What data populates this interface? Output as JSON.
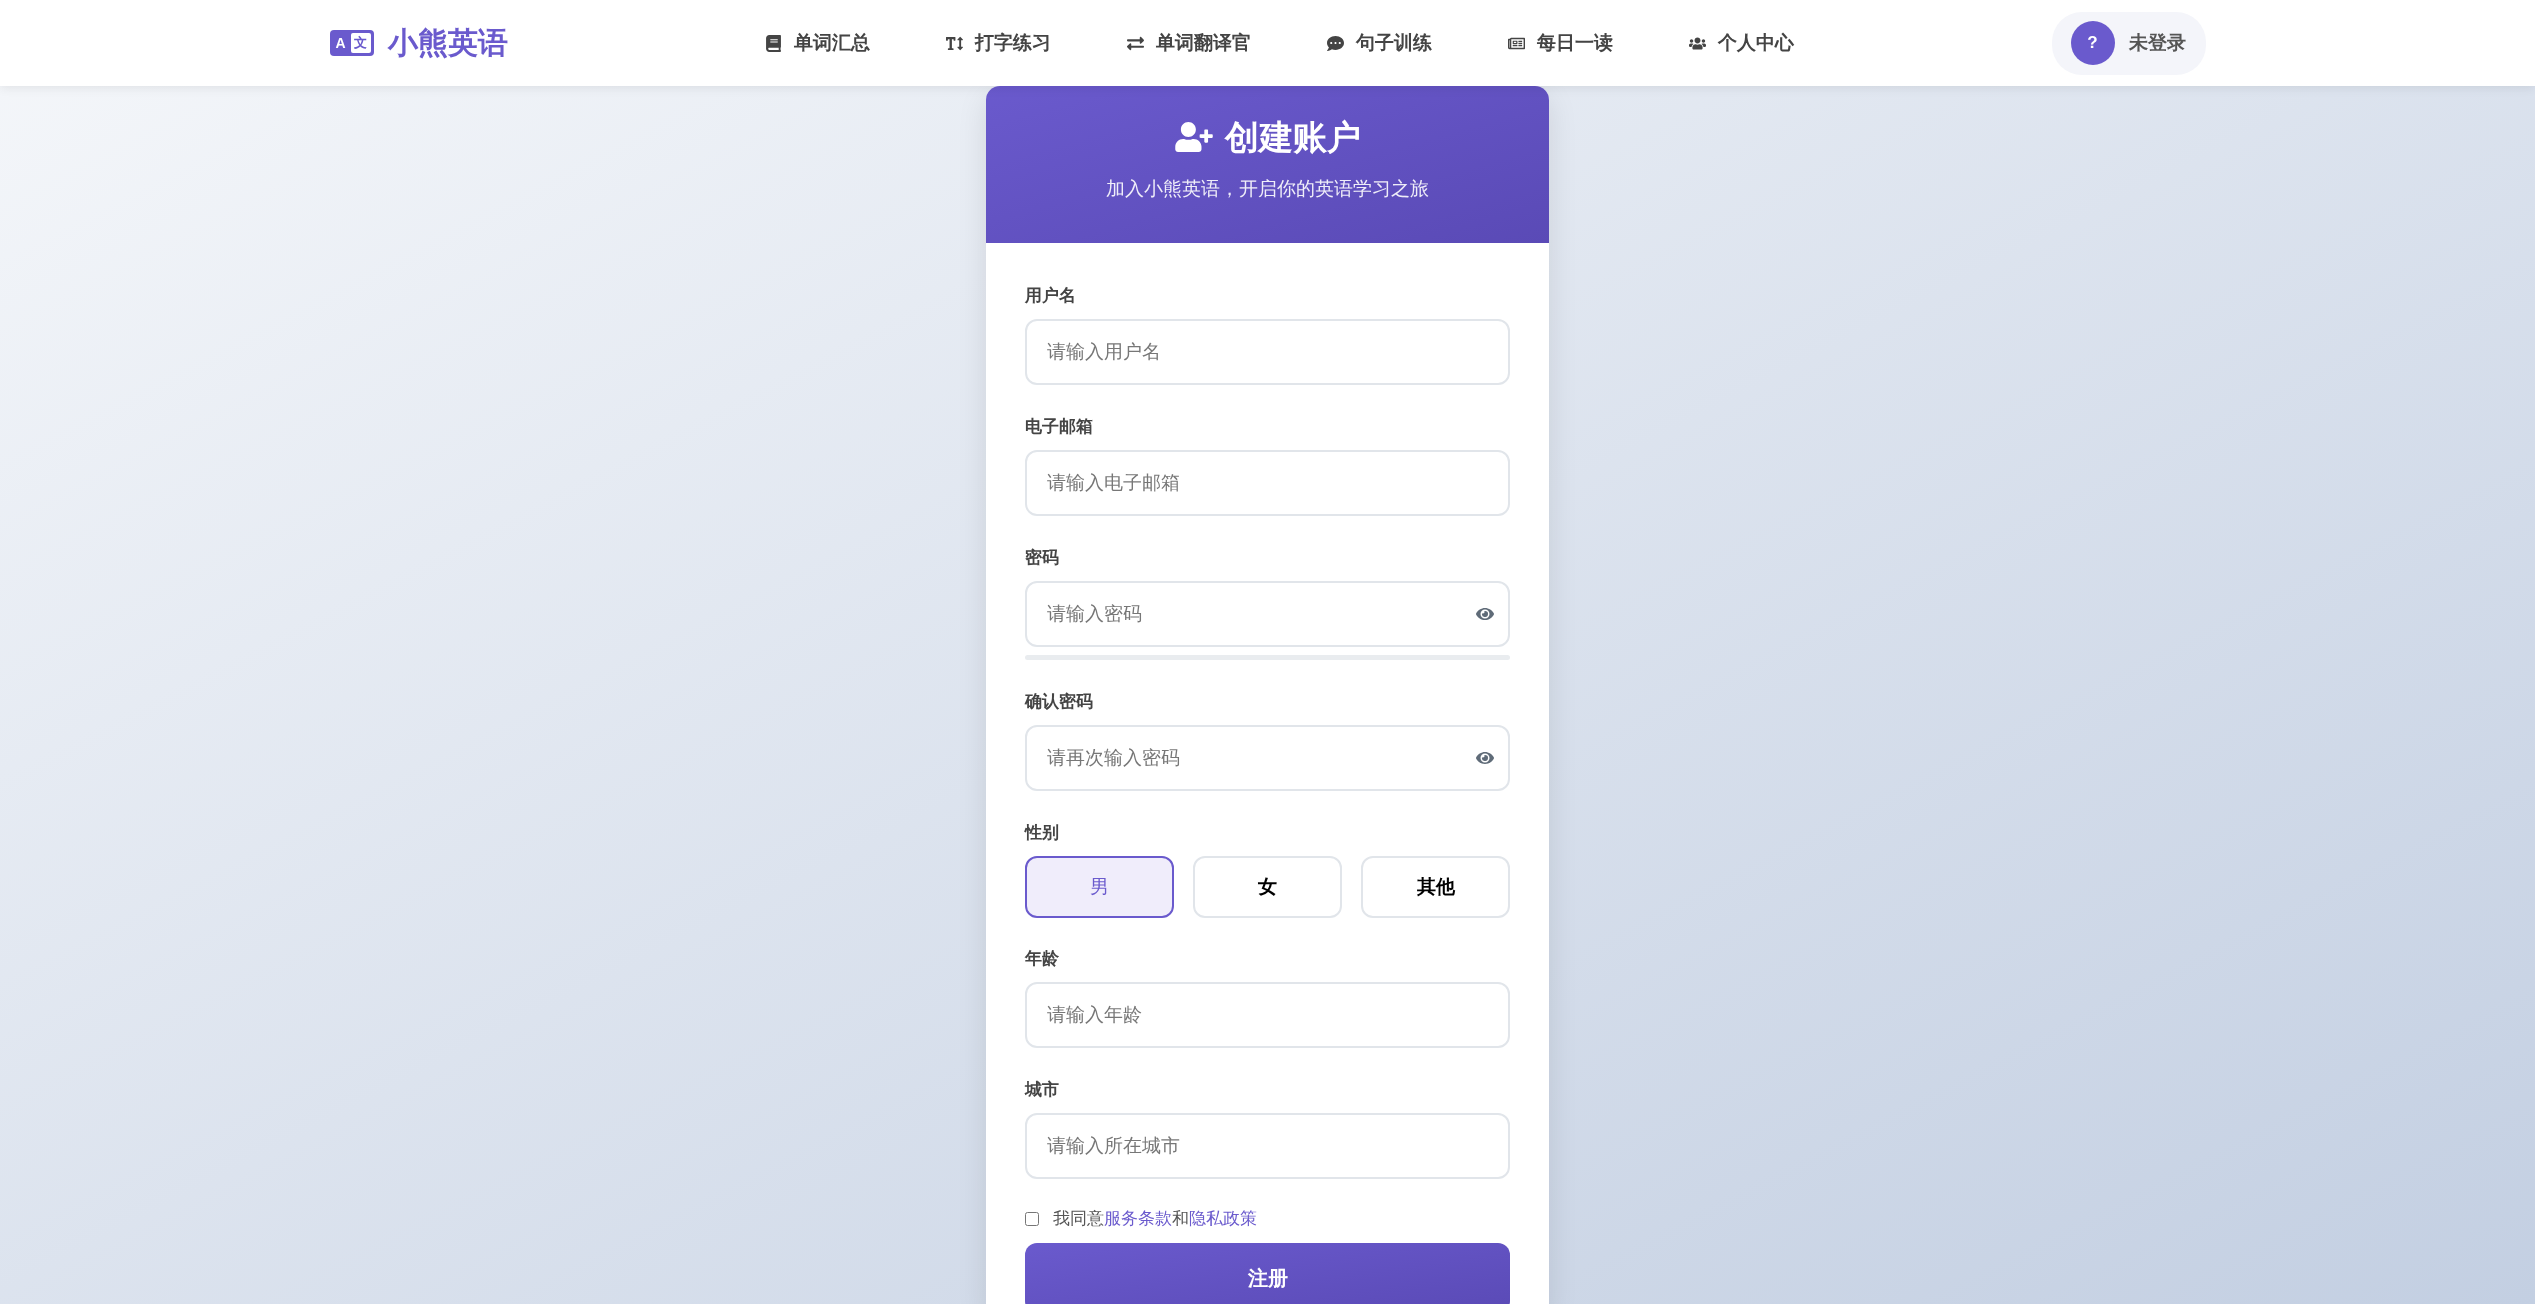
{
  "nav": {
    "logo_badge": [
      "A",
      "文"
    ],
    "logo": "小熊英语",
    "items": [
      {
        "label": "单词汇总",
        "selected": false
      },
      {
        "label": "打字练习",
        "selected": false
      },
      {
        "label": "单词翻译官",
        "selected": false
      },
      {
        "label": "句子训练",
        "selected": false
      },
      {
        "label": "每日一读",
        "selected": false
      },
      {
        "label": "个人中心",
        "selected": false
      }
    ],
    "user": {
      "avatar": "?",
      "label": "未登录"
    }
  },
  "card": {
    "title": "创建账户",
    "subtitle": "加入小熊英语，开启你的英语学习之旅"
  },
  "form": {
    "fields": [
      {
        "kind": "text",
        "label": "用户名",
        "placeholder": "请输入用户名"
      },
      {
        "kind": "text",
        "label": "电子邮箱",
        "placeholder": "请输入电子邮箱"
      },
      {
        "kind": "password",
        "label": "密码",
        "placeholder": "请输入密码",
        "strength": {
          "level": 0
        }
      },
      {
        "kind": "password",
        "label": "确认密码",
        "placeholder": "请再次输入密码"
      },
      {
        "kind": "choice",
        "label": "性别",
        "options": [
          {
            "label": "男",
            "selected": true
          },
          {
            "label": "女",
            "selected": false
          },
          {
            "label": "其他",
            "selected": false
          }
        ]
      },
      {
        "kind": "text",
        "label": "年龄",
        "placeholder": "请输入年龄"
      },
      {
        "kind": "text",
        "label": "城市",
        "placeholder": "请输入所在城市"
      }
    ],
    "agreement": {
      "checked": false,
      "parts": [
        {
          "kind": "text",
          "text": "我同意"
        },
        {
          "kind": "link",
          "text": "服务条款"
        },
        {
          "kind": "text",
          "text": "和"
        },
        {
          "kind": "link",
          "text": "隐私政策"
        }
      ]
    },
    "submit": "注册"
  }
}
